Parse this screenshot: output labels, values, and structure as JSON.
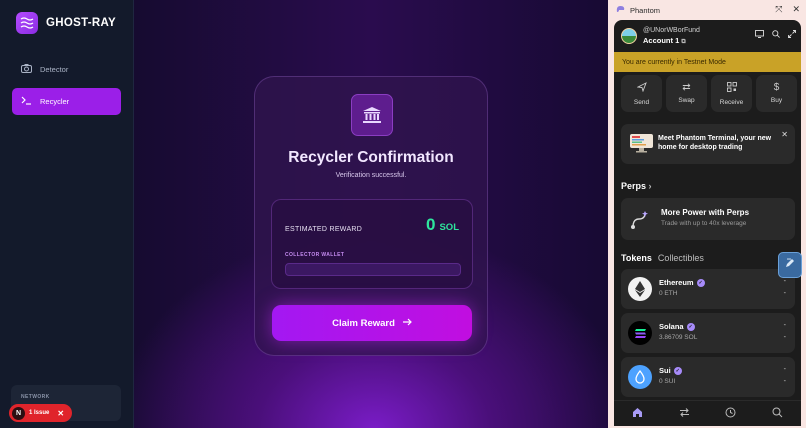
{
  "app": {
    "brand_name": "GHOST-RAY",
    "nav": [
      {
        "label": "Detector",
        "icon": "camera-icon",
        "active": false
      },
      {
        "label": "Recycler",
        "icon": "terminal-icon",
        "active": true
      }
    ],
    "network_label": "NETWORK",
    "issue": {
      "badge": "N",
      "label": "1 Issue"
    }
  },
  "card": {
    "title": "Recycler Confirmation",
    "subtitle": "Verification successful.",
    "estimated_label": "ESTIMATED REWARD",
    "estimated_value": "0",
    "estimated_unit": "SOL",
    "collector_label": "COLLECTOR WALLET",
    "collector_value": "",
    "claim_label": "Claim Reward"
  },
  "phantom": {
    "title": "Phantom",
    "handle": "@UNorWBorFund",
    "account": "Account 1",
    "testnet_notice": "You are currently in Testnet Mode",
    "actions": [
      {
        "label": "Send",
        "icon": "send-icon"
      },
      {
        "label": "Swap",
        "icon": "swap-icon"
      },
      {
        "label": "Receive",
        "icon": "qr-icon"
      },
      {
        "label": "Buy",
        "icon": "dollar-icon"
      }
    ],
    "promo_text": "Meet Phantom Terminal, your new home for desktop trading",
    "perps_heading": "Perps",
    "perps_title": "More Power with Perps",
    "perps_sub": "Trade with up to 40x leverage",
    "tabs": [
      "Tokens",
      "Collectibles"
    ],
    "tokens": [
      {
        "name": "Ethereum",
        "balance": "0 ETH",
        "value": "-",
        "change": "-"
      },
      {
        "name": "Solana",
        "balance": "3.86709 SOL",
        "value": "-",
        "change": "-"
      },
      {
        "name": "Sui",
        "balance": "0 SUI",
        "value": "-",
        "change": "-"
      }
    ]
  },
  "colors": {
    "accent": "#9b1fe8",
    "reward_green": "#2ee59d",
    "testnet_banner": "#c9a227"
  }
}
